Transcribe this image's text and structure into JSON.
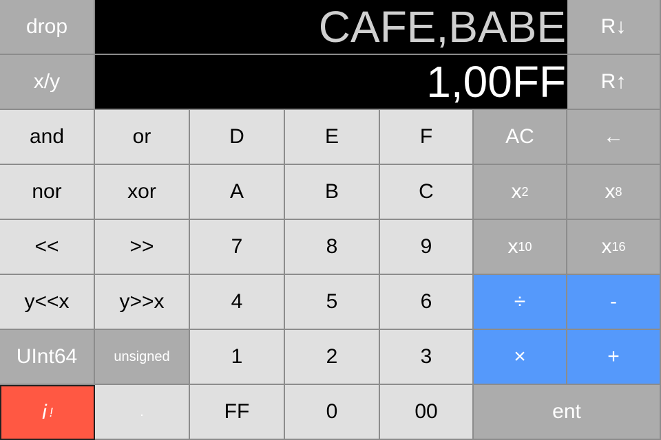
{
  "display": {
    "stack_y": "CAFE,BABE",
    "stack_x": "1,00FF"
  },
  "keys": {
    "drop": "drop",
    "xy": "x/y",
    "roll_down": "R↓",
    "roll_up": "R↑",
    "and": "and",
    "or": "or",
    "D": "D",
    "E": "E",
    "F": "F",
    "ac": "AC",
    "backspace": "←",
    "nor": "nor",
    "xor": "xor",
    "A": "A",
    "B": "B",
    "C": "C",
    "x2": {
      "base": "x",
      "sub": "2"
    },
    "x8": {
      "base": "x",
      "sub": "8"
    },
    "shl": "<<",
    "shr": ">>",
    "7": "7",
    "8": "8",
    "9": "9",
    "x10": {
      "base": "x",
      "sub": "10"
    },
    "x16": {
      "base": "x",
      "sub": "16"
    },
    "yshl": "y<<x",
    "yshr": "y>>x",
    "4": "4",
    "5": "5",
    "6": "6",
    "div": "÷",
    "sub": "-",
    "type": "UInt64",
    "signed": "unsigned",
    "1": "1",
    "2": "2",
    "3": "3",
    "mul": "×",
    "add": "+",
    "info": {
      "base": "i",
      "sup": "!"
    },
    "dot": ".",
    "FF": "FF",
    "0": "0",
    "00": "00",
    "ent": "ent"
  },
  "colors": {
    "light_key": "#e0e0e0",
    "dark_key": "#acacac",
    "operator": "#5599fb",
    "info": "#ff5843",
    "display_bg": "#000000"
  }
}
